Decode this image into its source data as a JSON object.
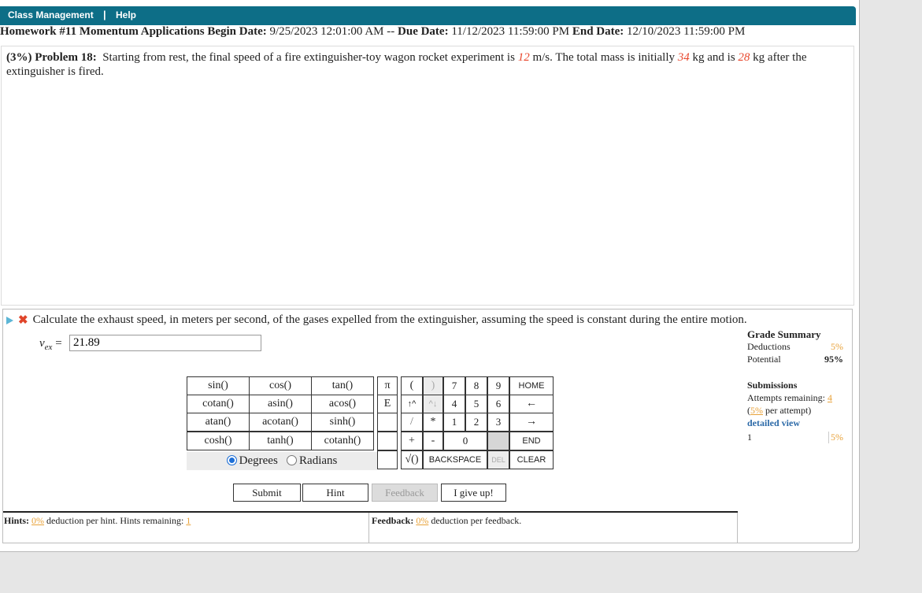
{
  "topbar": {
    "class_management": "Class Management",
    "separator": "|",
    "help": "Help"
  },
  "hw": {
    "title": "Homework #11 Momentum Applications",
    "begin_label": "Begin Date:",
    "begin_value": "9/25/2023 12:01:00 AM --",
    "due_label": "Due Date:",
    "due_value": "11/12/2023 11:59:00 PM",
    "end_label": "End Date:",
    "end_value": "12/10/2023 11:59:00 PM"
  },
  "problem": {
    "weight": "(3%)",
    "label": "Problem 18:",
    "t1": "Starting from rest, the final speed of a fire extinguisher-toy wagon rocket experiment is",
    "speed": "12",
    "t2": "m/s. The total mass is initially",
    "m1": "34",
    "t3": "kg and is",
    "m2": "28",
    "t4": "kg after the extinguisher is fired."
  },
  "question": {
    "text": "Calculate the exhaust speed, in meters per second, of the gases expelled from the extinguisher, assuming the speed is constant during the entire motion.",
    "var": "v",
    "sub": "ex",
    "eq": "=",
    "answer": "21.89"
  },
  "grade": {
    "title": "Grade Summary",
    "deductions_label": "Deductions",
    "deductions_value": "5%",
    "potential_label": "Potential",
    "potential_value": "95%",
    "submissions_title": "Submissions",
    "attempts_label": "Attempts remaining:",
    "attempts_value": "4",
    "per_attempt_open": "(",
    "per_attempt_value": "5%",
    "per_attempt_text": "per attempt)",
    "detailed_view": "detailed view",
    "sub_num": "1",
    "sub_value": "5%"
  },
  "calc": {
    "funcs": [
      "sin()",
      "cos()",
      "tan()",
      "cotan()",
      "asin()",
      "acos()",
      "atan()",
      "acotan()",
      "sinh()",
      "cosh()",
      "tanh()",
      "cotanh()"
    ],
    "pi": "π",
    "lparen": "(",
    "rparen": ")",
    "E": "E",
    "uparr": "↑^",
    "dnarr": "^↓",
    "slash": "/",
    "star": "*",
    "plus": "+",
    "minus": "-",
    "sqrt": "√()",
    "backspace": "BACKSPACE",
    "del": "DEL",
    "clear": "CLEAR",
    "home": "HOME",
    "left": "←",
    "right": "→",
    "end": "END",
    "n7": "7",
    "n8": "8",
    "n9": "9",
    "n4": "4",
    "n5": "5",
    "n6": "6",
    "n1": "1",
    "n2": "2",
    "n3": "3",
    "n0": "0",
    "degrees": "Degrees",
    "radians": "Radians"
  },
  "buttons": {
    "submit": "Submit",
    "hint": "Hint",
    "feedback": "Feedback",
    "giveup": "I give up!"
  },
  "footer": {
    "hints_label": "Hints:",
    "hints_pct": "0%",
    "hints_text": "deduction per hint. Hints remaining:",
    "hints_remaining": "1",
    "feedback_label": "Feedback:",
    "feedback_pct": "0%",
    "feedback_text": "deduction per feedback."
  },
  "colors": {
    "topbar": "#0d6e87",
    "red_values": "#e8472d",
    "orange": "#e8a23a",
    "link": "#2c6aa8"
  }
}
